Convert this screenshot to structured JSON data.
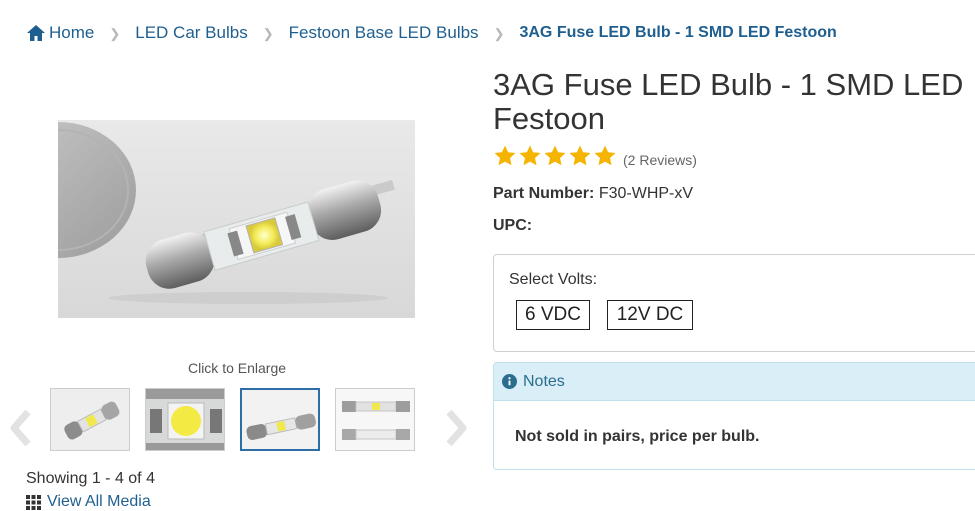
{
  "breadcrumb": {
    "home": "Home",
    "items": [
      "LED Car Bulbs",
      "Festoon Base LED Bulbs"
    ],
    "current": "3AG Fuse LED Bulb - 1 SMD LED Festoon",
    "separator": ">"
  },
  "gallery": {
    "click_to_enlarge": "Click to Enlarge",
    "showing": "Showing 1 - 4 of 4",
    "view_all": "View All Media",
    "active_thumb_index": 2
  },
  "product": {
    "title": "3AG Fuse LED Bulb - 1 SMD LED Festoon",
    "rating": 5,
    "reviews": "(2 Reviews)",
    "part_number_label": "Part Number:",
    "part_number": "F30-WHP-xV",
    "upc_label": "UPC:"
  },
  "options": {
    "label": "Select Volts:",
    "choices": [
      "6 VDC",
      "12V DC"
    ]
  },
  "notes": {
    "header": "Notes",
    "text": "Not sold in pairs, price per bulb."
  },
  "colors": {
    "link": "#1f5f8f",
    "star": "#f5b400",
    "notes_bg": "#d9eef6",
    "active_border": "#2e6ea6"
  },
  "icons": [
    "home-icon",
    "chevron-right-icon",
    "star-icon",
    "info-icon",
    "grid-icon",
    "chevron-left-icon"
  ]
}
